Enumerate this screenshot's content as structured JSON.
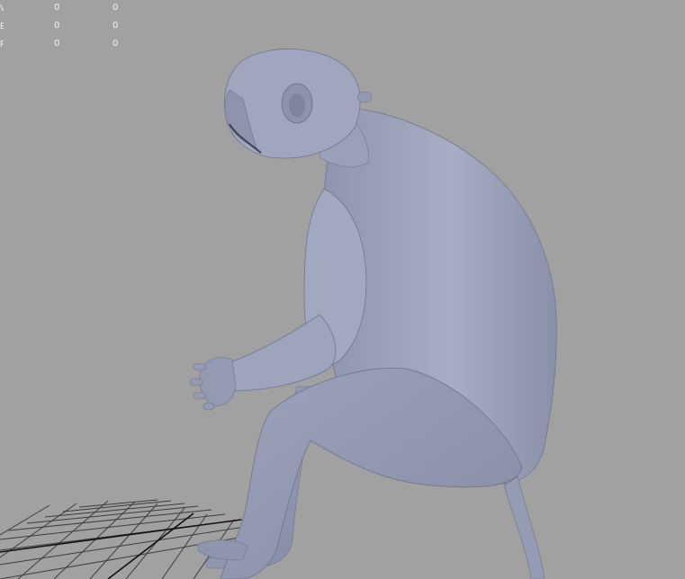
{
  "hud": {
    "rows": [
      {
        "label": "Verts:",
        "col1": "0",
        "col2": "0"
      },
      {
        "label": "Edges:",
        "col1": "0",
        "col2": "0"
      },
      {
        "label": "Faces:",
        "col1": "0",
        "col2": "0"
      }
    ]
  },
  "viewport": {
    "background_color": "#a1a1a1",
    "model_color": "#9aa0b8",
    "grid_color": "#2b2b2b"
  }
}
